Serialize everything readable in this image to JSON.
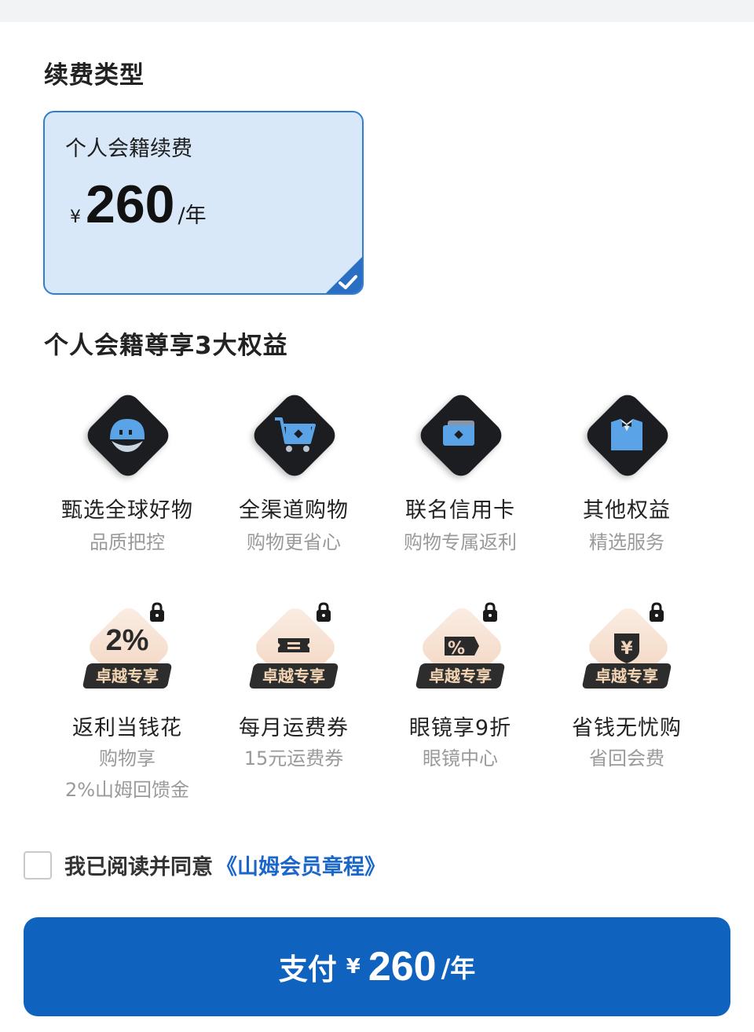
{
  "sections": {
    "renewal_type_title": "续费类型",
    "benefits_title": "个人会籍尊享3大权益"
  },
  "plan": {
    "name": "个人会籍续费",
    "currency": "¥",
    "price": "260",
    "unit": "/年",
    "selected": true
  },
  "benefits": [
    {
      "title": "甄选全球好物",
      "sub": "品质把控",
      "icon": "globe-helmet-icon"
    },
    {
      "title": "全渠道购物",
      "sub": "购物更省心",
      "icon": "shopping-cart-icon"
    },
    {
      "title": "联名信用卡",
      "sub": "购物专属返利",
      "icon": "credit-card-icon"
    },
    {
      "title": "其他权益",
      "sub": "精选服务",
      "icon": "suit-icon"
    }
  ],
  "premium_benefits": [
    {
      "title": "返利当钱花",
      "sub": "购物享",
      "sub2": "2%山姆回馈金",
      "badge": "卓越专享",
      "icon_text": "2%",
      "icon": "rebate-icon"
    },
    {
      "title": "每月运费券",
      "sub": "15元运费券",
      "badge": "卓越专享",
      "icon_text": "",
      "icon": "ticket-icon"
    },
    {
      "title": "眼镜享9折",
      "sub": "眼镜中心",
      "badge": "卓越专享",
      "icon_text": "%",
      "icon": "discount-icon"
    },
    {
      "title": "省钱无忧购",
      "sub": "省回会费",
      "badge": "卓越专享",
      "icon_text": "¥",
      "icon": "yen-shield-icon"
    }
  ],
  "agreement": {
    "text": "我已阅读并同意",
    "link": "《山姆会员章程》",
    "checked": false
  },
  "pay_button": {
    "label": "支付",
    "currency": "¥",
    "amount": "260",
    "unit": "/年"
  },
  "colors": {
    "accent": "#0f63bf",
    "card_bg": "#d9e8f8",
    "card_border": "#2f7fd1",
    "link": "#1b66c9"
  }
}
